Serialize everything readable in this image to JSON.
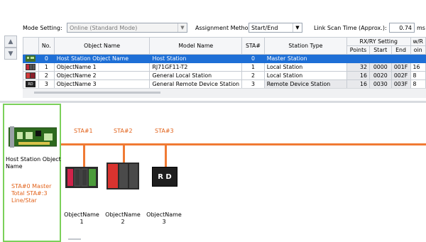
{
  "toolbar": {
    "mode_label": "Mode Setting:",
    "mode_value": "Online (Standard Mode)",
    "assign_label": "Assignment Method:",
    "assign_value": "Start/End",
    "scan_label": "Link Scan Time (Approx.):",
    "scan_value": "0.74",
    "scan_unit": "ms"
  },
  "table": {
    "headers": {
      "no": "No.",
      "object_name": "Object Name",
      "model_name": "Model Name",
      "sta": "STA#",
      "station_type": "Station Type",
      "rxry": "RX/RY Setting",
      "points": "Points",
      "start": "Start",
      "end": "End",
      "wr": "w/R",
      "wr_points": "oin"
    },
    "rows": [
      {
        "no": "0",
        "object_name": "Host Station Object Name",
        "model_name": "Host Station",
        "sta": "0",
        "station_type": "Master Station",
        "points": "",
        "start": "",
        "end": "",
        "wr": ""
      },
      {
        "no": "1",
        "object_name": "ObjectName 1",
        "model_name": "RJ71GF11-T2",
        "sta": "1",
        "station_type": "Local Station",
        "points": "32",
        "start": "0000",
        "end": "001F",
        "wr": "16"
      },
      {
        "no": "2",
        "object_name": "ObjectName 2",
        "model_name": "General Local Station",
        "sta": "2",
        "station_type": "Local Station",
        "points": "16",
        "start": "0020",
        "end": "002F",
        "wr": "8"
      },
      {
        "no": "3",
        "object_name": "ObjectName 3",
        "model_name": "General Remote Device Station",
        "sta": "3",
        "station_type": "Remote Device Station",
        "points": "16",
        "start": "0030",
        "end": "003F",
        "wr": "8"
      }
    ]
  },
  "diagram": {
    "host_name": "Host Station Object Name",
    "host_info": [
      "STA#0 Master",
      "Total STA#:3",
      "Line/Star"
    ],
    "sta_labels": [
      "STA#1",
      "STA#2",
      "STA#3"
    ],
    "rd_label": "R D",
    "devices": [
      {
        "name": "ObjectName",
        "num": "1"
      },
      {
        "name": "ObjectName",
        "num": "2"
      },
      {
        "name": "ObjectName",
        "num": "3"
      }
    ]
  },
  "colors": {
    "accent": "#1e6fd6",
    "network": "#f07a34",
    "host_border": "#7bd05a",
    "sta_text": "#e2631c"
  }
}
